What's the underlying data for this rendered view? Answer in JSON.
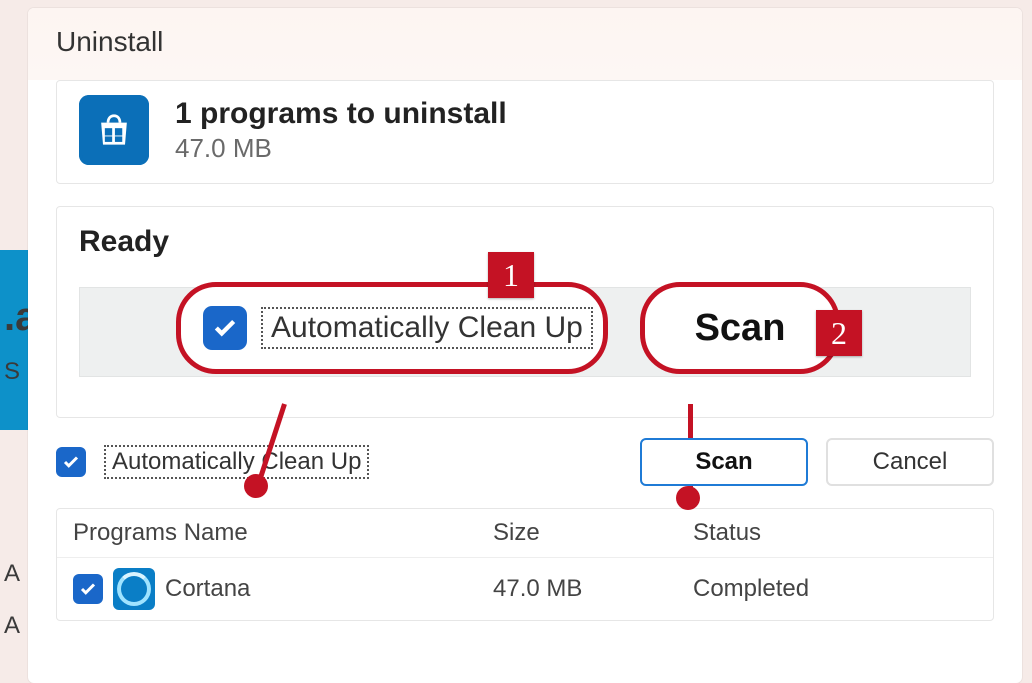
{
  "window": {
    "title": "Uninstall"
  },
  "summary": {
    "headline": "1 programs to uninstall",
    "size": "47.0 MB"
  },
  "status": {
    "label": "Ready"
  },
  "options": {
    "auto_clean_label_big": "Automatically Clean Up",
    "auto_clean_label_small": "Automatically Clean Up",
    "auto_clean_checked": true
  },
  "buttons": {
    "scan_big": "Scan",
    "scan": "Scan",
    "cancel": "Cancel"
  },
  "annotations": {
    "badge1": "1",
    "badge2": "2"
  },
  "table": {
    "headers": {
      "name": "Programs Name",
      "size": "Size",
      "status": "Status"
    },
    "rows": [
      {
        "checked": true,
        "name": "Cortana",
        "size": "47.0 MB",
        "status": "Completed"
      }
    ]
  },
  "colors": {
    "accent_red": "#c41224",
    "accent_blue": "#1a67c9"
  },
  "bg_letters": {
    "a1": ".a",
    "s": "S",
    "A1": "A",
    "A2": "A"
  }
}
